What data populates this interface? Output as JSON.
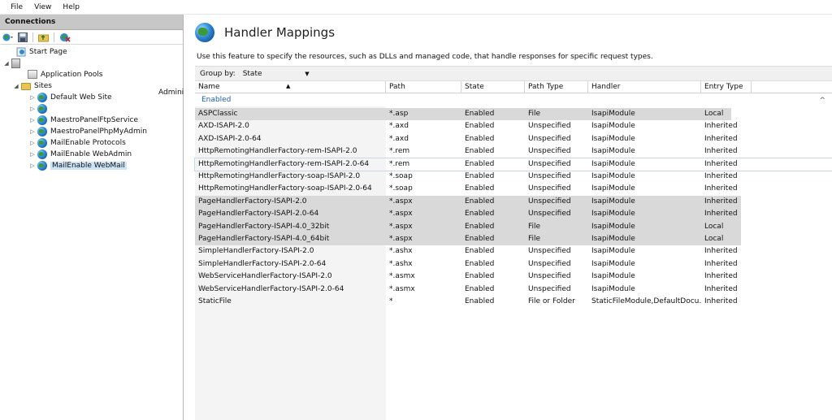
{
  "menu": [
    "File",
    "View",
    "Help"
  ],
  "connections": {
    "title": "Connections",
    "toolbar_icons": [
      "connect-icon",
      "save-icon",
      "up-folder-icon",
      "disconnect-icon"
    ],
    "tree": [
      {
        "label": "Start Page",
        "icon": "start-page-icon",
        "level": 0,
        "expander": ""
      },
      {
        "label": "",
        "icon": "server-icon",
        "level": 0,
        "expander": "◢"
      },
      {
        "label": "Application Pools",
        "icon": "app-pools-icon",
        "level": 1,
        "expander": ""
      },
      {
        "label": "Sites",
        "icon": "sites-folder-icon",
        "level": 1,
        "expander": "◢"
      },
      {
        "label": "Default Web Site",
        "icon": "globe-icon",
        "level": 2,
        "expander": "▷"
      },
      {
        "label": "",
        "icon": "globe-icon",
        "level": 2,
        "expander": "▷"
      },
      {
        "label": "MaestroPanelFtpService",
        "icon": "globe-icon",
        "level": 2,
        "expander": "▷"
      },
      {
        "label": "MaestroPanelPhpMyAdmin",
        "icon": "globe-icon",
        "level": 2,
        "expander": "▷"
      },
      {
        "label": "MailEnable Protocols",
        "icon": "globe-icon",
        "level": 2,
        "expander": "▷"
      },
      {
        "label": "MailEnable WebAdmin",
        "icon": "globe-icon",
        "level": 2,
        "expander": "▷"
      },
      {
        "label": "MailEnable WebMail",
        "icon": "globe-icon",
        "level": 2,
        "expander": "▷",
        "selected": true
      }
    ],
    "server_name_trunc": "Admini"
  },
  "main": {
    "title": "Handler Mappings",
    "description": "Use this feature to specify the resources, such as DLLs and managed code, that handle responses for specific request types.",
    "group_by_label": "Group by:",
    "group_by_value": "State",
    "group_name": "Enabled",
    "columns": [
      "Name",
      "Path",
      "State",
      "Path Type",
      "Handler",
      "Entry Type"
    ],
    "rows": [
      {
        "name": "ASPClassic",
        "path": "*.asp",
        "state": "Enabled",
        "path_type": "File",
        "handler": "IsapiModule",
        "entry": "Local",
        "hl": true
      },
      {
        "name": "AXD-ISAPI-2.0",
        "path": "*.axd",
        "state": "Enabled",
        "path_type": "Unspecified",
        "handler": "IsapiModule",
        "entry": "Inherited"
      },
      {
        "name": "AXD-ISAPI-2.0-64",
        "path": "*.axd",
        "state": "Enabled",
        "path_type": "Unspecified",
        "handler": "IsapiModule",
        "entry": "Inherited"
      },
      {
        "name": "HttpRemotingHandlerFactory-rem-ISAPI-2.0",
        "path": "*.rem",
        "state": "Enabled",
        "path_type": "Unspecified",
        "handler": "IsapiModule",
        "entry": "Inherited"
      },
      {
        "name": "HttpRemotingHandlerFactory-rem-ISAPI-2.0-64",
        "path": "*.rem",
        "state": "Enabled",
        "path_type": "Unspecified",
        "handler": "IsapiModule",
        "entry": "Inherited",
        "focus": true
      },
      {
        "name": "HttpRemotingHandlerFactory-soap-ISAPI-2.0",
        "path": "*.soap",
        "state": "Enabled",
        "path_type": "Unspecified",
        "handler": "IsapiModule",
        "entry": "Inherited"
      },
      {
        "name": "HttpRemotingHandlerFactory-soap-ISAPI-2.0-64",
        "path": "*.soap",
        "state": "Enabled",
        "path_type": "Unspecified",
        "handler": "IsapiModule",
        "entry": "Inherited"
      },
      {
        "name": "PageHandlerFactory-ISAPI-2.0",
        "path": "*.aspx",
        "state": "Enabled",
        "path_type": "Unspecified",
        "handler": "IsapiModule",
        "entry": "Inherited",
        "hl": true
      },
      {
        "name": "PageHandlerFactory-ISAPI-2.0-64",
        "path": "*.aspx",
        "state": "Enabled",
        "path_type": "Unspecified",
        "handler": "IsapiModule",
        "entry": "Inherited",
        "hl": true
      },
      {
        "name": "PageHandlerFactory-ISAPI-4.0_32bit",
        "path": "*.aspx",
        "state": "Enabled",
        "path_type": "File",
        "handler": "IsapiModule",
        "entry": "Local",
        "hl": true
      },
      {
        "name": "PageHandlerFactory-ISAPI-4.0_64bit",
        "path": "*.aspx",
        "state": "Enabled",
        "path_type": "File",
        "handler": "IsapiModule",
        "entry": "Local",
        "hl": true
      },
      {
        "name": "SimpleHandlerFactory-ISAPI-2.0",
        "path": "*.ashx",
        "state": "Enabled",
        "path_type": "Unspecified",
        "handler": "IsapiModule",
        "entry": "Inherited"
      },
      {
        "name": "SimpleHandlerFactory-ISAPI-2.0-64",
        "path": "*.ashx",
        "state": "Enabled",
        "path_type": "Unspecified",
        "handler": "IsapiModule",
        "entry": "Inherited"
      },
      {
        "name": "WebServiceHandlerFactory-ISAPI-2.0",
        "path": "*.asmx",
        "state": "Enabled",
        "path_type": "Unspecified",
        "handler": "IsapiModule",
        "entry": "Inherited"
      },
      {
        "name": "WebServiceHandlerFactory-ISAPI-2.0-64",
        "path": "*.asmx",
        "state": "Enabled",
        "path_type": "Unspecified",
        "handler": "IsapiModule",
        "entry": "Inherited"
      },
      {
        "name": "StaticFile",
        "path": "*",
        "state": "Enabled",
        "path_type": "File or Folder",
        "handler": "StaticFileModule,DefaultDocu...",
        "entry": "Inherited"
      }
    ]
  },
  "colors": {
    "highlight_row": "#d9d9d9",
    "focus_outline": "#c9d7ea",
    "group_text": "#1a5fb4"
  }
}
